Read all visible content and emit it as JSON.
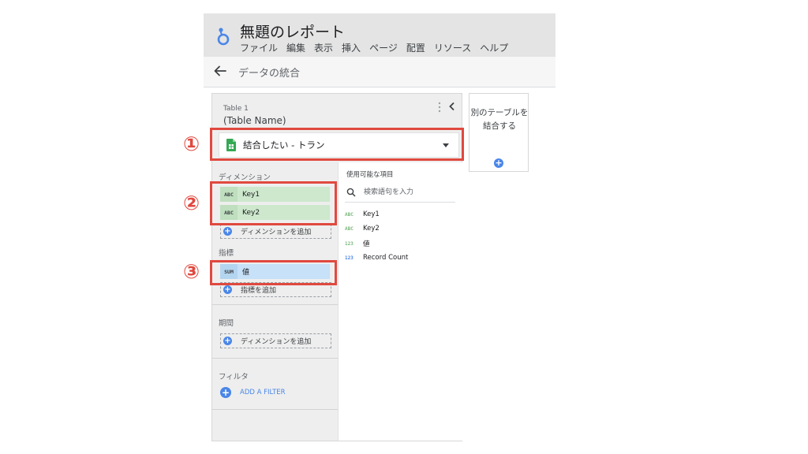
{
  "header": {
    "title": "無題のレポート",
    "menu": [
      "ファイル",
      "編集",
      "表示",
      "挿入",
      "ページ",
      "配置",
      "リソース",
      "ヘルプ"
    ]
  },
  "toolbar": {
    "title": "データの統合"
  },
  "panel": {
    "table_kicker": "Table 1",
    "table_name": "(Table Name)",
    "source_label": "結合したい - トラン",
    "dimensions_head": "ディメンション",
    "dimensions": [
      {
        "type": "ABC",
        "name": "Key1"
      },
      {
        "type": "ABC",
        "name": "Key2"
      }
    ],
    "add_dimension": "ディメンションを追加",
    "metrics_head": "指標",
    "metrics": [
      {
        "type": "SUM",
        "name": "値"
      }
    ],
    "add_metric": "指標を追加",
    "date_range_head": "期間",
    "add_date_dimension": "ディメンションを追加",
    "filter_head": "フィルタ",
    "add_filter": "ADD A FILTER",
    "available_head": "使用可能な項目",
    "search_placeholder": "検索語句を入力",
    "available_fields": [
      {
        "type": "ABC",
        "name": "Key1",
        "color": "#7cb87c"
      },
      {
        "type": "ABC",
        "name": "Key2",
        "color": "#7cb87c"
      },
      {
        "type": "123",
        "name": "値",
        "color": "#7cb87c"
      },
      {
        "type": "123",
        "name": "Record Count",
        "color": "#4a86e8"
      }
    ]
  },
  "add_table": {
    "label": "別のテーブルを結合する"
  },
  "annotations": {
    "marker1": "①",
    "marker2": "②",
    "marker3": "③"
  },
  "colors": {
    "accent": "#4a86e8",
    "annotation": "#e0493f",
    "dimension": "#cde8cd",
    "metric": "#c6e1f8"
  }
}
